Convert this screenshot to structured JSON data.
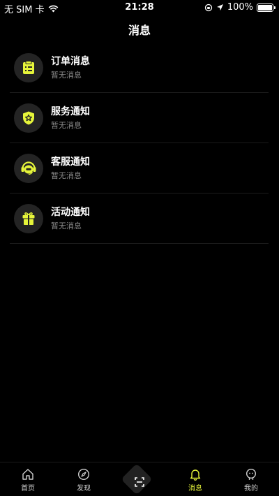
{
  "status_bar": {
    "carrier": "无 SIM 卡",
    "time": "21:28",
    "battery": "100%"
  },
  "header": {
    "title": "消息"
  },
  "messages": [
    {
      "title": "订单消息",
      "subtitle": "暂无消息",
      "icon": "clipboard-icon"
    },
    {
      "title": "服务通知",
      "subtitle": "暂无消息",
      "icon": "shield-star-icon"
    },
    {
      "title": "客服通知",
      "subtitle": "暂无消息",
      "icon": "headset-icon"
    },
    {
      "title": "活动通知",
      "subtitle": "暂无消息",
      "icon": "gift-icon"
    }
  ],
  "tabs": [
    {
      "label": "首页",
      "icon": "home-icon"
    },
    {
      "label": "发现",
      "icon": "discover-icon"
    },
    {
      "label": "",
      "icon": "scan-icon"
    },
    {
      "label": "消息",
      "icon": "bell-icon",
      "active": true
    },
    {
      "label": "我的",
      "icon": "profile-icon"
    }
  ],
  "colors": {
    "accent": "#e6f53a",
    "background": "#000000",
    "icon_circle": "#242424"
  }
}
